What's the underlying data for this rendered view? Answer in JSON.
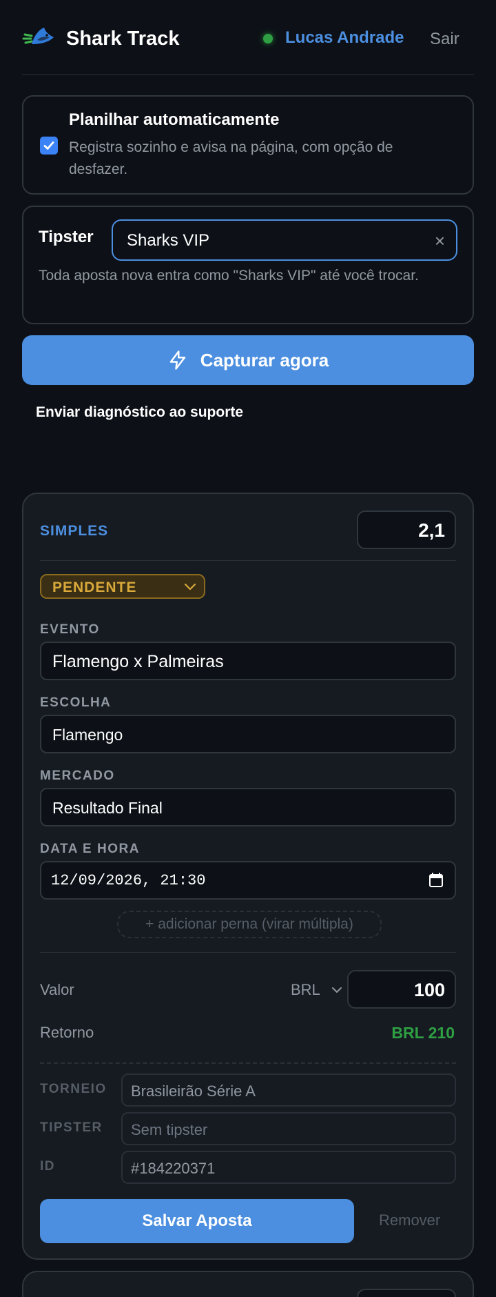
{
  "header": {
    "title": "Shark Track",
    "user_name": "Lucas Andrade",
    "logout_label": "Sair",
    "status_color": "#2ea043"
  },
  "auto_panel": {
    "checked": true,
    "title": "Planilhar automaticamente",
    "description": "Registra sozinho e avisa na página, com opção de desfazer."
  },
  "tipster_panel": {
    "label": "Tipster",
    "value": "Sharks VIP",
    "clear_icon": "×",
    "hint": "Toda aposta nova entra como \"Sharks VIP\" até você trocar."
  },
  "capture_button": {
    "label": "Capturar agora",
    "icon": "lightning-icon"
  },
  "diagnostic_link": "Enviar diagnóstico ao suporte",
  "bet": {
    "type": "SIMPLES",
    "odd": "2,1",
    "status": "PENDENTE",
    "fields": {
      "evento_label": "EVENTO",
      "evento_value": "Flamengo x Palmeiras",
      "escolha_label": "ESCOLHA",
      "escolha_value": "Flamengo",
      "mercado_label": "MERCADO",
      "mercado_value": "Resultado Final",
      "data_label": "DATA E HORA",
      "data_value": "12/09/2026, 21:30"
    },
    "add_leg_label": "+ adicionar perna (virar múltipla)",
    "valor_label": "Valor",
    "currency": "BRL",
    "valor_value": "100",
    "retorno_label": "Retorno",
    "retorno_value": "BRL 210",
    "meta": {
      "torneio_label": "TORNEIO",
      "torneio_value": "Brasileirão Série A",
      "tipster_label": "TIPSTER",
      "tipster_placeholder": "Sem tipster",
      "id_label": "ID",
      "id_value": "#184220371"
    },
    "save_label": "Salvar Aposta",
    "remove_label": "Remover"
  },
  "colors": {
    "accent": "#4c8fe0",
    "background": "#0d1117",
    "card": "#161b22",
    "pending": "#d9a93b",
    "positive": "#2ea043"
  }
}
